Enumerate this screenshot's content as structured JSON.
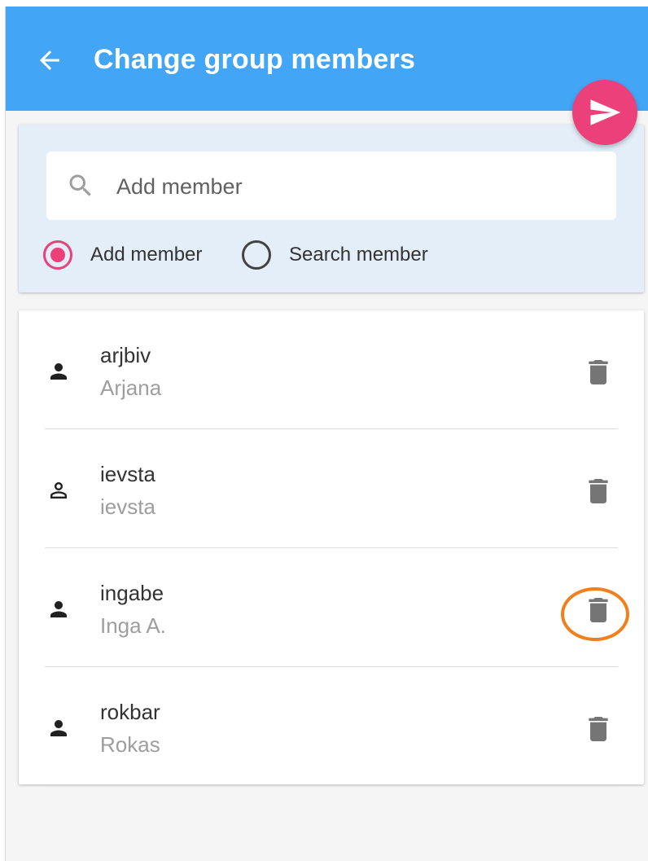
{
  "header": {
    "title": "Change group members",
    "back_icon": "arrow-left-icon",
    "send_icon": "send-icon",
    "color": "#42a5f5",
    "fab_color": "#ec407a"
  },
  "search": {
    "placeholder": "Add member",
    "value": "",
    "icon": "search-icon",
    "mode_options": [
      {
        "label": "Add member",
        "selected": true
      },
      {
        "label": "Search member",
        "selected": false
      }
    ]
  },
  "members": [
    {
      "username": "arjbiv",
      "name": "Arjana",
      "icon": "person-icon"
    },
    {
      "username": "ievsta",
      "name": "ievsta",
      "icon": "person-outline-icon"
    },
    {
      "username": "ingabe",
      "name": "Inga A.",
      "icon": "person-icon",
      "highlighted": true
    },
    {
      "username": "rokbar",
      "name": "Rokas",
      "icon": "person-icon"
    }
  ],
  "delete_icon": "trash-icon",
  "highlight_color": "#f07f1c"
}
